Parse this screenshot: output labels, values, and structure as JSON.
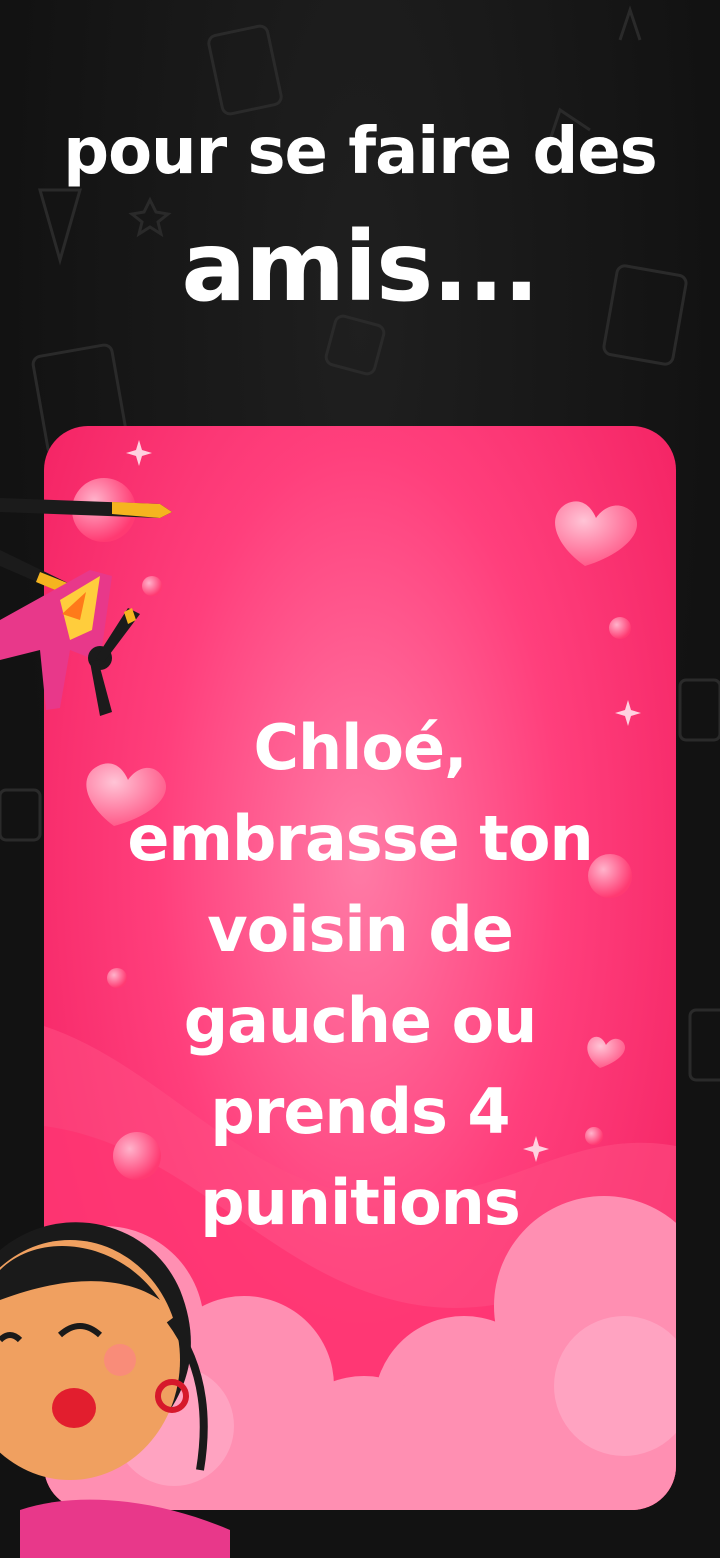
{
  "headline": {
    "line1": "pour se faire des",
    "line2": "amis..."
  },
  "card": {
    "lines": [
      "Chloé,",
      "embrasse ton",
      "voisin de",
      "gauche ou",
      "prends 4",
      "punitions"
    ]
  },
  "colors": {
    "background": "#141414",
    "card_pink": "#ff3f7c",
    "card_pink_dark": "#f01a5c",
    "text": "#ffffff",
    "accent_yellow": "#f5b41f"
  },
  "icons": [
    "helicopter-icon",
    "girl-kiss-avatar",
    "heart-icon",
    "sparkle-icon",
    "bubble-icon"
  ]
}
